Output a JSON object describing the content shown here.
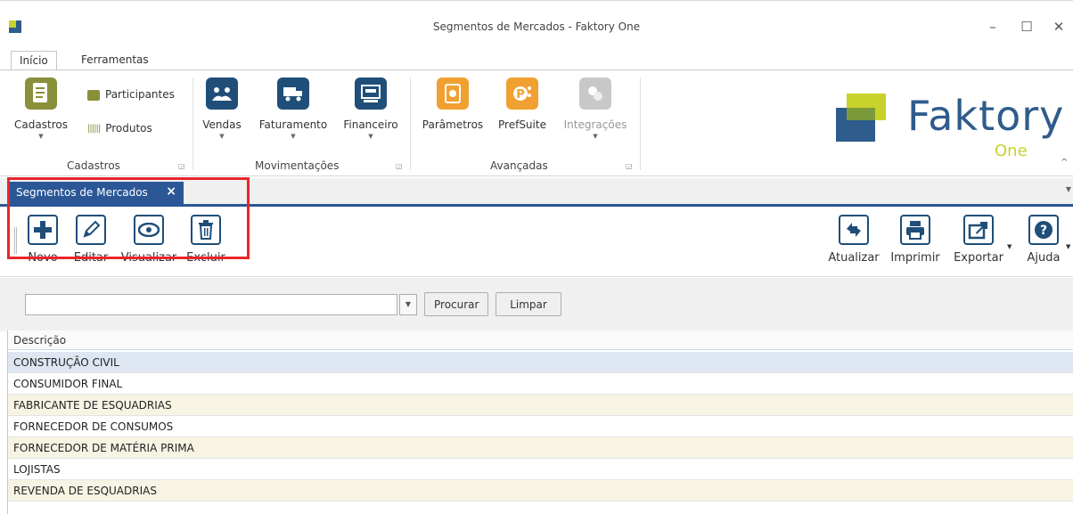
{
  "window": {
    "title": "Segmentos de Mercados - Faktory One",
    "minimize_icon": "minimize-icon",
    "maximize_icon": "maximize-icon",
    "close_icon": "close-icon"
  },
  "ribbon": {
    "tabs": [
      {
        "label": "Início",
        "active": true
      },
      {
        "label": "Ferramentas",
        "active": false
      }
    ],
    "groups": {
      "cadastros": {
        "label": "Cadastros",
        "big_label": "Cadastros",
        "participantes": "Participantes",
        "produtos": "Produtos"
      },
      "movimentacoes": {
        "label": "Movimentações",
        "vendas": "Vendas",
        "faturamento": "Faturamento",
        "financeiro": "Financeiro"
      },
      "avancadas": {
        "label": "Avançadas",
        "parametros": "Parâmetros",
        "prefsuite": "PrefSuite",
        "integracoes": "Integrações"
      }
    },
    "logo": {
      "brand": "Faktory",
      "sub": "One"
    }
  },
  "doc_tab": {
    "label": "Segmentos de Mercados",
    "close": "×"
  },
  "toolbar": {
    "novo": "Novo",
    "editar": "Editar",
    "visualizar": "Visualizar",
    "excluir": "Excluir",
    "atualizar": "Atualizar",
    "imprimir": "Imprimir",
    "exportar": "Exportar",
    "ajuda": "Ajuda"
  },
  "search": {
    "value": "",
    "procurar": "Procurar",
    "limpar": "Limpar"
  },
  "grid": {
    "column": "Descrição",
    "rows": [
      "CONSTRUÇÃO CIVIL",
      "CONSUMIDOR FINAL",
      "FABRICANTE DE ESQUADRIAS",
      "FORNECEDOR DE CONSUMOS",
      "FORNECEDOR DE MATÉRIA PRIMA",
      "LOJISTAS",
      "REVENDA DE ESQUADRIAS"
    ]
  },
  "colors": {
    "accent": "#2b5797",
    "highlight": "#e8262b",
    "brand_green": "#c7d22a",
    "brand_blue": "#2e5c8c",
    "orange": "#f0a030"
  }
}
